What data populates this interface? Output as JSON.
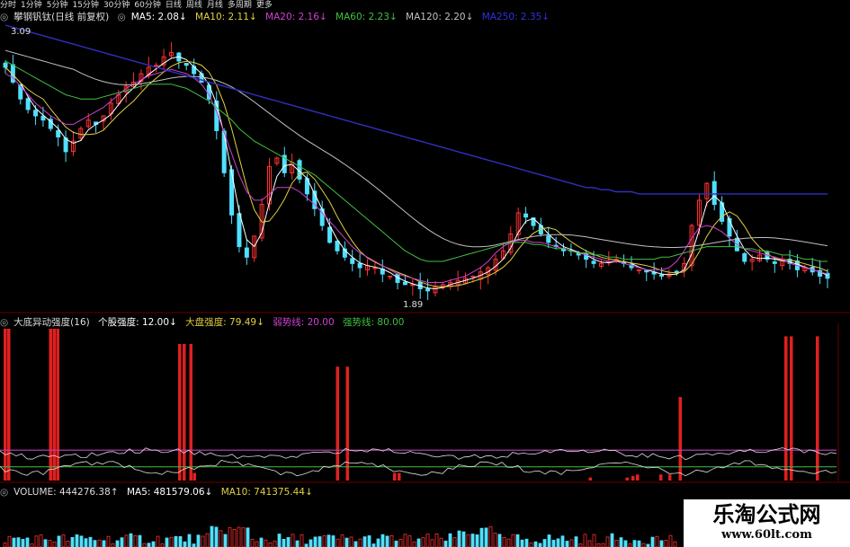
{
  "toolbar": {
    "items": [
      "分时",
      "1分钟",
      "5分钟",
      "15分钟",
      "30分钟",
      "60分钟",
      "日线",
      "周线",
      "月线",
      "多周期",
      "更多"
    ]
  },
  "price_legend": {
    "title": "攀钢钒钛(日线 前复权)",
    "ma5": "MA5: 2.08↓",
    "ma10": "MA10: 2.11↓",
    "ma20": "MA20: 2.16↓",
    "ma60": "MA60: 2.23↓",
    "ma120": "MA120: 2.20↓",
    "ma250": "MA250: 2.35↓"
  },
  "indicator_legend": {
    "title": "大底异动强度(16)",
    "stock_strength": "个股强度: 12.00↓",
    "market_strength": "大盘强度: 79.49↓",
    "weak_line": "弱势线: 20.00",
    "strong_line": "强势线: 80.00"
  },
  "volume_legend": {
    "title": "VOLUME: 444276.38↑",
    "ma5": "MA5: 481579.06↓",
    "ma10": "MA10: 741375.44↓"
  },
  "watermark": {
    "title": "乐淘公式网",
    "url": "www.60lt.com"
  },
  "colors": {
    "up": "#ff3030",
    "down": "#50e0ff",
    "ma5": "#ffffff",
    "ma10": "#e0d040",
    "ma20": "#d040d0",
    "ma60": "#40c040",
    "ma120": "#c0c0c0",
    "ma250": "#3030c0",
    "signal_bar": "#e02020",
    "weak_line": "#c040c0",
    "strong_line": "#40c040"
  },
  "chart_data": [
    {
      "type": "candlestick",
      "title": "攀钢钒钛(日线 前复权)",
      "annotations": {
        "high": "3.09",
        "low": "1.89"
      },
      "ylim": [
        1.8,
        3.15
      ],
      "close": [
        2.95,
        2.88,
        2.8,
        2.75,
        2.72,
        2.7,
        2.66,
        2.62,
        2.55,
        2.6,
        2.66,
        2.7,
        2.68,
        2.72,
        2.78,
        2.82,
        2.86,
        2.88,
        2.92,
        2.95,
        2.96,
        3.0,
        3.02,
        2.98,
        2.96,
        2.92,
        2.88,
        2.8,
        2.65,
        2.45,
        2.25,
        2.1,
        2.05,
        2.15,
        2.3,
        2.48,
        2.52,
        2.45,
        2.5,
        2.42,
        2.35,
        2.28,
        2.2,
        2.12,
        2.08,
        2.05,
        2.02,
        2.0,
        2.01,
        2.0,
        1.97,
        1.96,
        1.93,
        1.92,
        1.92,
        1.9,
        1.89,
        1.91,
        1.92,
        1.93,
        1.94,
        1.95,
        1.96,
        1.98,
        2.0,
        2.04,
        2.08,
        2.16,
        2.26,
        2.24,
        2.2,
        2.16,
        2.12,
        2.1,
        2.08,
        2.08,
        2.06,
        2.04,
        2.02,
        2.02,
        2.03,
        2.04,
        2.02,
        2.0,
        1.99,
        1.98,
        1.97,
        1.96,
        1.97,
        1.98,
        2.02,
        2.2,
        2.32,
        2.4,
        2.3,
        2.22,
        2.15,
        2.08,
        2.03,
        2.04,
        2.06,
        2.04,
        2.02,
        2.04,
        2.02,
        1.99,
        2.0,
        1.98,
        1.96,
        1.95
      ],
      "ma20": [
        2.92,
        2.9,
        2.86,
        2.82,
        2.78,
        2.75,
        2.72,
        2.7,
        2.68,
        2.68,
        2.7,
        2.72,
        2.74,
        2.76,
        2.79,
        2.82,
        2.85,
        2.87,
        2.89,
        2.91,
        2.92,
        2.93,
        2.94,
        2.93,
        2.92,
        2.9,
        2.87,
        2.82,
        2.74,
        2.64,
        2.54,
        2.44,
        2.36,
        2.32,
        2.32,
        2.35,
        2.38,
        2.38,
        2.38,
        2.36,
        2.33,
        2.3,
        2.26,
        2.22,
        2.18,
        2.14,
        2.1,
        2.07,
        2.05,
        2.03,
        2.01,
        1.99,
        1.97,
        1.96,
        1.95,
        1.94,
        1.93,
        1.93,
        1.93,
        1.94,
        1.95,
        1.96,
        1.98,
        2.0,
        2.03,
        2.07,
        2.1,
        2.12,
        2.13,
        2.13,
        2.12,
        2.12,
        2.11,
        2.1,
        2.09,
        2.08,
        2.07,
        2.06,
        2.05,
        2.04,
        2.03,
        2.03,
        2.02,
        2.01,
        2.0,
        1.99,
        1.99,
        1.99,
        2.0,
        2.03,
        2.08,
        2.14,
        2.19,
        2.2,
        2.19,
        2.17,
        2.14,
        2.11,
        2.09,
        2.08,
        2.07,
        2.06,
        2.05,
        2.04,
        2.02,
        2.01,
        2.0,
        1.99,
        1.98,
        1.97
      ],
      "ma60": [
        2.98,
        2.96,
        2.94,
        2.92,
        2.9,
        2.88,
        2.86,
        2.84,
        2.82,
        2.81,
        2.8,
        2.8,
        2.8,
        2.81,
        2.82,
        2.83,
        2.84,
        2.85,
        2.86,
        2.87,
        2.87,
        2.87,
        2.87,
        2.86,
        2.85,
        2.83,
        2.81,
        2.79,
        2.76,
        2.73,
        2.7,
        2.66,
        2.63,
        2.6,
        2.58,
        2.56,
        2.54,
        2.52,
        2.5,
        2.48,
        2.46,
        2.44,
        2.41,
        2.38,
        2.35,
        2.32,
        2.29,
        2.26,
        2.23,
        2.2,
        2.17,
        2.14,
        2.11,
        2.08,
        2.06,
        2.04,
        2.03,
        2.03,
        2.03,
        2.04,
        2.05,
        2.06,
        2.07,
        2.08,
        2.09,
        2.1,
        2.11,
        2.12,
        2.12,
        2.12,
        2.11,
        2.11,
        2.1,
        2.09,
        2.09,
        2.08,
        2.07,
        2.07,
        2.06,
        2.06,
        2.05,
        2.05,
        2.04,
        2.04,
        2.04,
        2.04,
        2.04,
        2.05,
        2.05,
        2.06,
        2.07,
        2.08,
        2.09,
        2.1,
        2.1,
        2.1,
        2.1,
        2.1,
        2.09,
        2.09,
        2.08,
        2.08,
        2.07,
        2.06,
        2.06,
        2.05,
        2.04,
        2.04,
        2.03,
        2.03
      ],
      "ma250": [
        3.15,
        3.14,
        3.13,
        3.12,
        3.11,
        3.1,
        3.09,
        3.08,
        3.07,
        3.06,
        3.05,
        3.04,
        3.03,
        3.02,
        3.01,
        3.0,
        2.99,
        2.98,
        2.97,
        2.96,
        2.95,
        2.94,
        2.93,
        2.92,
        2.91,
        2.9,
        2.89,
        2.88,
        2.87,
        2.86,
        2.85,
        2.84,
        2.83,
        2.82,
        2.81,
        2.8,
        2.79,
        2.78,
        2.77,
        2.76,
        2.75,
        2.74,
        2.73,
        2.72,
        2.71,
        2.7,
        2.69,
        2.68,
        2.67,
        2.66,
        2.65,
        2.64,
        2.63,
        2.62,
        2.61,
        2.6,
        2.59,
        2.58,
        2.57,
        2.56,
        2.55,
        2.54,
        2.53,
        2.52,
        2.51,
        2.5,
        2.49,
        2.48,
        2.47,
        2.46,
        2.45,
        2.44,
        2.43,
        2.42,
        2.41,
        2.4,
        2.39,
        2.38,
        2.38,
        2.37,
        2.37,
        2.36,
        2.36,
        2.36,
        2.35,
        2.35,
        2.35,
        2.35,
        2.35,
        2.35,
        2.35,
        2.35,
        2.35,
        2.35,
        2.35,
        2.35,
        2.35,
        2.35,
        2.35,
        2.35,
        2.35,
        2.35,
        2.35,
        2.35,
        2.35,
        2.35,
        2.35,
        2.35,
        2.35,
        2.35
      ]
    },
    {
      "type": "bar",
      "title": "大底异动强度(16)",
      "ylim": [
        0,
        100
      ],
      "signal_bars": [
        {
          "x": 0.4,
          "value": 100
        },
        {
          "x": 1.2,
          "value": 100
        },
        {
          "x": 10.5,
          "value": 100
        },
        {
          "x": 11.3,
          "value": 100
        },
        {
          "x": 12.1,
          "value": 100
        },
        {
          "x": 39.2,
          "value": 90
        },
        {
          "x": 40.2,
          "value": 90
        },
        {
          "x": 41.7,
          "value": 90
        },
        {
          "x": 42.5,
          "value": 5
        },
        {
          "x": 74.3,
          "value": 75
        },
        {
          "x": 76.5,
          "value": 75
        },
        {
          "x": 87.0,
          "value": 5
        },
        {
          "x": 88.0,
          "value": 5
        },
        {
          "x": 130.5,
          "value": 2
        },
        {
          "x": 138.7,
          "value": 2
        },
        {
          "x": 140.0,
          "value": 3
        },
        {
          "x": 141.0,
          "value": 4
        },
        {
          "x": 146.2,
          "value": 4
        },
        {
          "x": 148.2,
          "value": 4
        },
        {
          "x": 150.5,
          "value": 55
        },
        {
          "x": 174.0,
          "value": 95
        },
        {
          "x": 175.2,
          "value": 95
        },
        {
          "x": 181.0,
          "value": 95
        }
      ],
      "weak_line": 20,
      "strong_line": 80
    },
    {
      "type": "bar",
      "title": "VOLUME"
    }
  ]
}
